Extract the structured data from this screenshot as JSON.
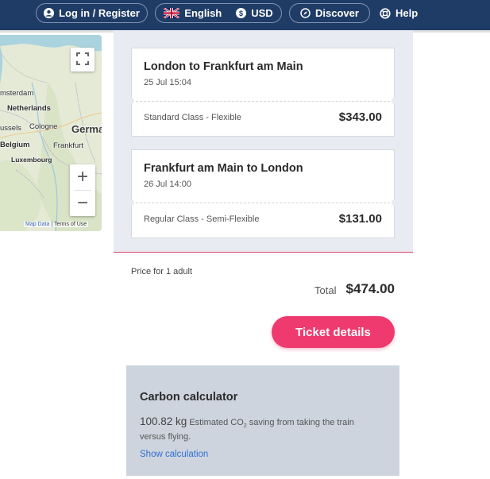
{
  "header": {
    "login_label": "Log in / Register",
    "language_label": "English",
    "currency_label": "USD",
    "discover_label": "Discover",
    "help_label": "Help",
    "colors": {
      "bar": "#1f3c66",
      "text": "#ffffff"
    },
    "icons": [
      "user-icon",
      "uk-flag-icon",
      "dollar-coin-icon",
      "compass-icon",
      "lifebuoy-icon"
    ]
  },
  "map": {
    "labels": {
      "amsterdam": "msterdam",
      "netherlands": "Netherlands",
      "brussels": "ussels",
      "cologne": "Cologne",
      "germany": "Germa",
      "belgium": "Belgium",
      "frankfurt": "Frankfurt",
      "luxembourg": "Luxembourg"
    },
    "zoom_in": "+",
    "zoom_out": "−",
    "footer_map_data": "Map Data",
    "footer_terms": "Terms of Use",
    "icons": [
      "fullscreen-icon"
    ]
  },
  "journeys": [
    {
      "route": "London to Frankfurt am Main",
      "datetime": "25 Jul 15:04",
      "class": "Standard Class - Flexible",
      "price": "$343.00"
    },
    {
      "route": "Frankfurt am Main to London",
      "datetime": "26 Jul 14:00",
      "class": "Regular Class - Semi-Flexible",
      "price": "$131.00"
    }
  ],
  "summary": {
    "price_for": "Price for 1 adult",
    "total_label": "Total",
    "total_value": "$474.00",
    "ticket_details_label": "Ticket details",
    "accent_color": "#ee3a6e"
  },
  "carbon": {
    "title": "Carbon calculator",
    "amount": "100.82 kg",
    "desc_part1": "Estimated CO",
    "desc_sub": "2",
    "desc_part2": " saving from taking the train",
    "desc_line2": "versus flying.",
    "link_label": "Show calculation"
  }
}
